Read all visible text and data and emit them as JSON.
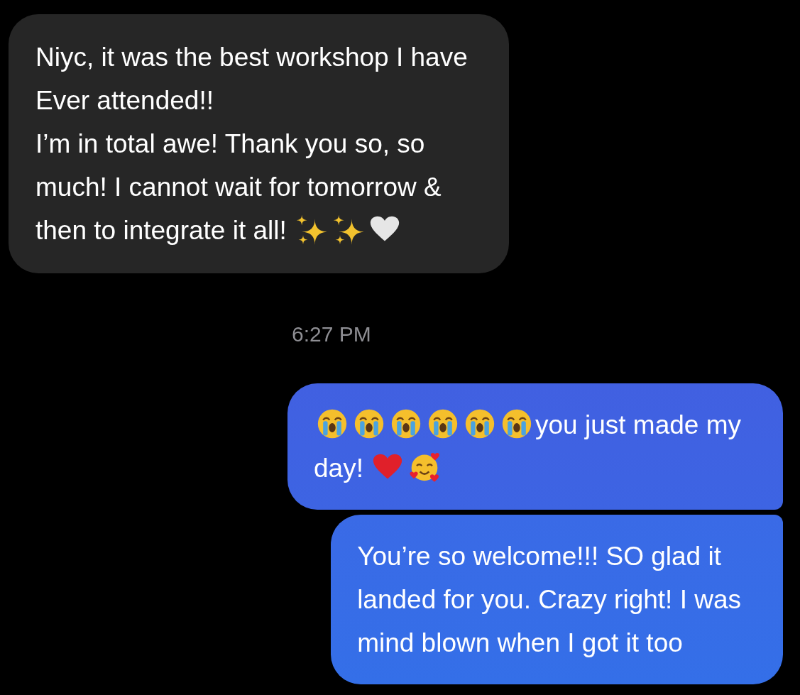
{
  "conversation": [
    {
      "kind": "incoming",
      "lines": [
        [
          {
            "kind": "text",
            "text": "Niyc, it was the best workshop I have"
          }
        ],
        [
          {
            "kind": "text",
            "text": "Ever attended!!"
          }
        ],
        [
          {
            "kind": "text",
            "text": "I’m in total awe! Thank you so, so"
          }
        ],
        [
          {
            "kind": "text",
            "text": "much! I cannot wait for tomorrow &"
          }
        ],
        [
          {
            "kind": "text",
            "text": "then to integrate it all!"
          },
          {
            "kind": "sparkles"
          },
          {
            "kind": "sparkles"
          },
          {
            "kind": "whiteheart"
          }
        ]
      ]
    },
    {
      "kind": "timestamp",
      "text": "6:27 PM"
    },
    {
      "kind": "outgoing",
      "lines": [
        [
          {
            "kind": "cryingface"
          },
          {
            "kind": "cryingface"
          },
          {
            "kind": "cryingface"
          },
          {
            "kind": "cryingface"
          },
          {
            "kind": "cryingface"
          },
          {
            "kind": "cryingface"
          },
          {
            "kind": "text",
            "text": "you just made my"
          }
        ],
        [
          {
            "kind": "text",
            "text": "day!"
          },
          {
            "kind": "redheart"
          },
          {
            "kind": "heartsface"
          }
        ]
      ]
    },
    {
      "kind": "outgoing",
      "lines": [
        [
          {
            "kind": "text",
            "text": "You’re so welcome!!! SO glad it"
          }
        ],
        [
          {
            "kind": "text",
            "text": "landed for you. Crazy right! I was"
          }
        ],
        [
          {
            "kind": "text",
            "text": "mind blown when I got it too"
          }
        ]
      ]
    }
  ]
}
